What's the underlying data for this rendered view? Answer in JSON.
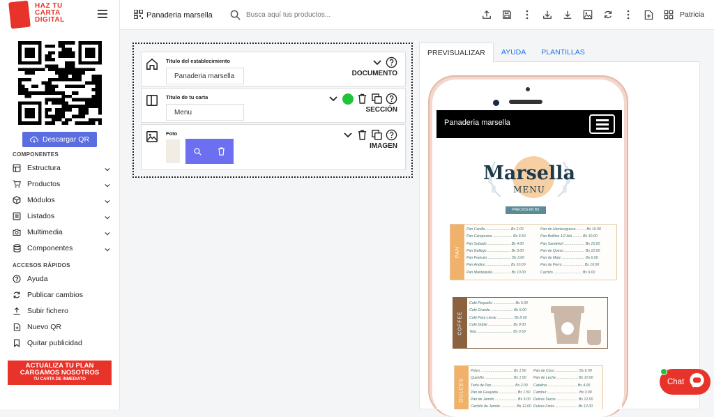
{
  "logo": {
    "line1": "HAZ TU",
    "line2": "CARTA",
    "line3": "DIGITAL"
  },
  "sidebar": {
    "download_qr": "Descargar QR",
    "components_title": "COMPONENTES",
    "components": [
      {
        "label": "Estructura",
        "icon": "layout-icon"
      },
      {
        "label": "Productos",
        "icon": "cart-icon"
      },
      {
        "label": "Módulos",
        "icon": "cube-icon"
      },
      {
        "label": "Listados",
        "icon": "list-icon"
      },
      {
        "label": "Multimedia",
        "icon": "camera-icon"
      },
      {
        "label": "Componentes",
        "icon": "database-icon"
      }
    ],
    "quick_title": "ACCESOS RÁPIDOS",
    "quick": [
      {
        "label": "Ayuda",
        "icon": "help-icon"
      },
      {
        "label": "Publicar cambios",
        "icon": "refresh-icon"
      },
      {
        "label": "Subir fichero",
        "icon": "upload-icon"
      },
      {
        "label": "Nuevo QR",
        "icon": "file-plus-icon"
      },
      {
        "label": "Quitar publicidad",
        "icon": "bookmark-icon"
      }
    ],
    "promo": {
      "line1": "ACTUALIZA TU PLAN",
      "line2": "CARGAMOS NOSOTROS",
      "line3": "TU CARTA DE INMEDIATO"
    }
  },
  "topbar": {
    "doc_title": "Panaderia marsella",
    "search_placeholder": "Busca aquí tus productos...",
    "user": "Patricia"
  },
  "editor": {
    "blocks": [
      {
        "label": "Titulo del establecimiento",
        "value": "Panaderia marsella",
        "type": "DOCUMENTO"
      },
      {
        "label": "Titulo de tu carta",
        "value": "Menu",
        "type": "SECCIÓN"
      },
      {
        "label": "Foto",
        "type": "IMAGEN"
      }
    ]
  },
  "preview": {
    "tabs": [
      "PREVISUALIZAR",
      "AYUDA",
      "PLANTILLAS"
    ],
    "screen_title": "Panaderia marsella",
    "brand_name": "Marsella",
    "brand_sub": "MENU",
    "brand_tag": "PRECIOS EN BS",
    "cards": [
      {
        "name": "PAN",
        "color": "#f0b26b",
        "left": "Pan Canilla ........................ Bs 2.00\nPan Campesino ................... Bs 3.50\nPan Sobado ....................... Bs 4.00\nPan Gallego ....................... Bs 3.00\nPan Francés ....................... Bs 3.00\nPan Andino ........................ Bs 10.00\nPan Mantequilla ................. Bs 10.00",
        "right": "Pan de Hamburguesa ......... Bs 10.00\nPan Bollitos 1/2 kilo ......... Bs 10.00\nPan Sandwich .................... Bs 15.00\nPan de Queso .................... Bs 12.00\nPan de Maíz ....................... Bs 6.00\nPan de Perro ..................... Bs 10.00\nCachito ............................ Bs 9.00"
      },
      {
        "name": "COFFEE",
        "color": "#8b6240",
        "left": "Cafe Pequeño ..................... Bs 5.00\nCafe Grande ...................... Bs 5.00\nCafe Para Llevar ................ Bs 8.50\nCafe Doble ........................ Bs 9.00\nTeta ................................... Bs 0.50",
        "right": ""
      },
      {
        "name": "DULCES",
        "color": "#f0b26b",
        "left": "Polvo ................................ Bs 1.50\nQuesillo ............................ Bs 1.50\nTorta de Pan ...................... Bs 2.00\nPan de Guayaba .................. Bs 1.50\nPan de Jamón ...................... Bs 3.00\nCachito de Jamón ............... Bs 12.00",
        "right": "Pan de Coco ....................... Bs 6.00\nPan de Leche ..................... Bs 10.00\nCatalina ............................. Bs 4.00\nCambur ............................... Bs 3.00\nDulces Secos ..................... Bs 12.00\nDulces Finos ...................... Bs 12.00"
      }
    ]
  },
  "chat": {
    "label": "Chat"
  },
  "colors": {
    "accent": "#5b6ee1",
    "brand_red": "#e8332a",
    "green": "#1ec43c"
  }
}
